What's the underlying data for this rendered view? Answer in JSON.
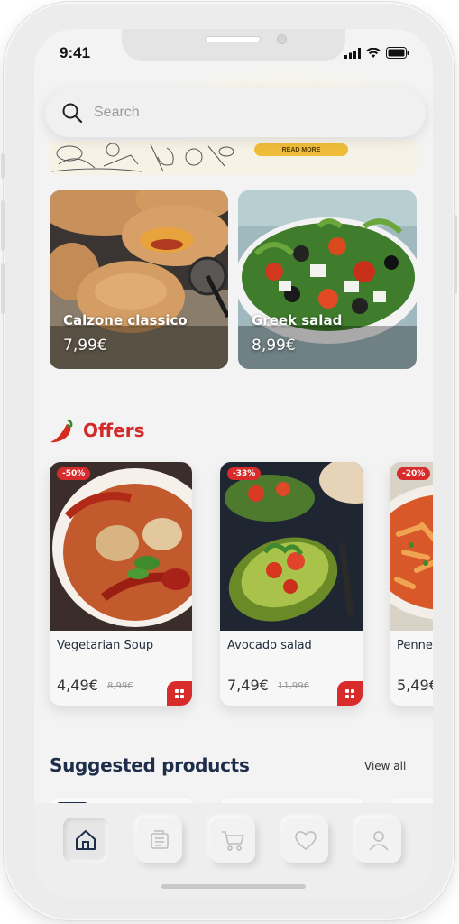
{
  "status_bar": {
    "time": "9:41"
  },
  "search": {
    "placeholder": "Search",
    "icon": "search-icon"
  },
  "banner": {
    "button_label": "READ MORE"
  },
  "featured": [
    {
      "name": "Calzone classico",
      "price": "7,99€"
    },
    {
      "name": "Greek salad",
      "price": "8,99€"
    }
  ],
  "offers": {
    "title": "Offers",
    "icon": "chili-pepper-icon",
    "items": [
      {
        "discount": "-50%",
        "name": "Vegetarian Soup",
        "price": "4,49€",
        "old_price": "8,99€"
      },
      {
        "discount": "-33%",
        "name": "Avocado salad",
        "price": "7,49€",
        "old_price": "11,99€"
      },
      {
        "discount": "-20%",
        "name": "Penne",
        "price": "5,49€",
        "old_price": ""
      }
    ]
  },
  "suggested": {
    "title": "Suggested products",
    "view_all": "View all"
  },
  "tabbar": {
    "items": [
      {
        "icon": "home-icon",
        "active": true
      },
      {
        "icon": "orders-icon",
        "active": false
      },
      {
        "icon": "cart-icon",
        "active": false
      },
      {
        "icon": "heart-icon",
        "active": false
      },
      {
        "icon": "profile-icon",
        "active": false
      }
    ]
  },
  "colors": {
    "accent_red": "#d82c2c",
    "title_navy": "#1d2d4a",
    "banner_yellow": "#f0bd3a"
  }
}
